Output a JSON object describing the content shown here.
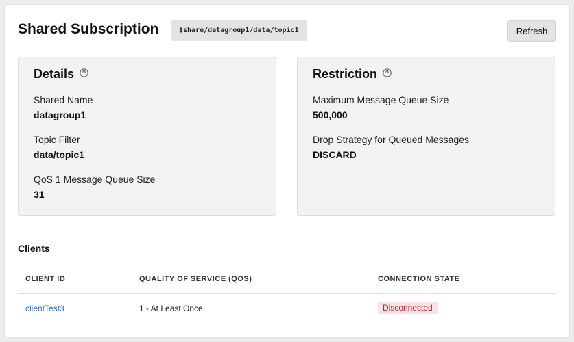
{
  "header": {
    "title": "Shared Subscription",
    "topic": "$share/datagroup1/data/topic1",
    "refresh_label": "Refresh"
  },
  "details": {
    "title": "Details",
    "help_icon": "help-circle-icon",
    "fields": [
      {
        "label": "Shared Name",
        "value": "datagroup1"
      },
      {
        "label": "Topic Filter",
        "value": "data/topic1"
      },
      {
        "label": "QoS 1 Message Queue Size",
        "value": "31"
      }
    ]
  },
  "restriction": {
    "title": "Restriction",
    "help_icon": "help-circle-icon",
    "fields": [
      {
        "label": "Maximum Message Queue Size",
        "value": "500,000"
      },
      {
        "label": "Drop Strategy for Queued Messages",
        "value": "DISCARD"
      }
    ]
  },
  "clients": {
    "title": "Clients",
    "columns": [
      "CLIENT ID",
      "QUALITY OF SERVICE (QOS)",
      "CONNECTION STATE"
    ],
    "rows": [
      {
        "client_id": "clientTest3",
        "qos": "1 - At Least Once",
        "state": "Disconnected"
      }
    ]
  },
  "colors": {
    "link": "#2f6fcf",
    "status_disconnected_bg": "#fbe1e1",
    "status_disconnected_text": "#b3262b"
  }
}
